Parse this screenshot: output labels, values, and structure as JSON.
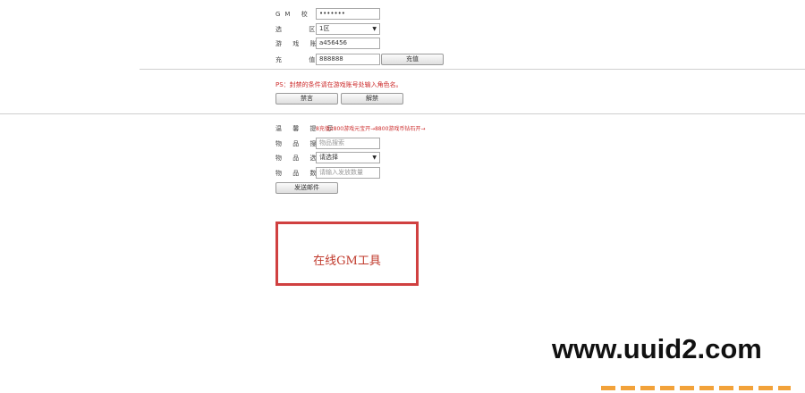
{
  "account": {
    "gm_code_label": "GM 校 验 码",
    "gm_code_value": "•••••••",
    "region_label": "选 区",
    "region_value": "1区",
    "game_account_label": "游 戏 账 号",
    "game_account_value": "a456456",
    "recharge_label": "充 值",
    "recharge_value": "888888",
    "recharge_button": "充值"
  },
  "ps": {
    "note": "PS：封禁的条件请在游戏账号处输入角色名。",
    "ban_button": "禁言",
    "unban_button": "解禁"
  },
  "mail": {
    "tip_label": "温 馨 提 示",
    "tip_text": "8充值2800游戏元宝开→8800游戏币钻石开→",
    "item_search_label": "物 品 搜 索",
    "item_search_placeholder": "物品搜索",
    "item_select_label": "物 品 选 择",
    "item_select_value": "请选择",
    "item_count_label": "物 品 数 量",
    "item_count_placeholder": "请输入发放数量",
    "send_button": "发送邮件"
  },
  "banner": {
    "text": "在线GM工具"
  },
  "watermark": {
    "text": "www.uuid2.com"
  },
  "colors": {
    "accent_red": "#cc2a2a",
    "banner_border": "#d04040"
  }
}
